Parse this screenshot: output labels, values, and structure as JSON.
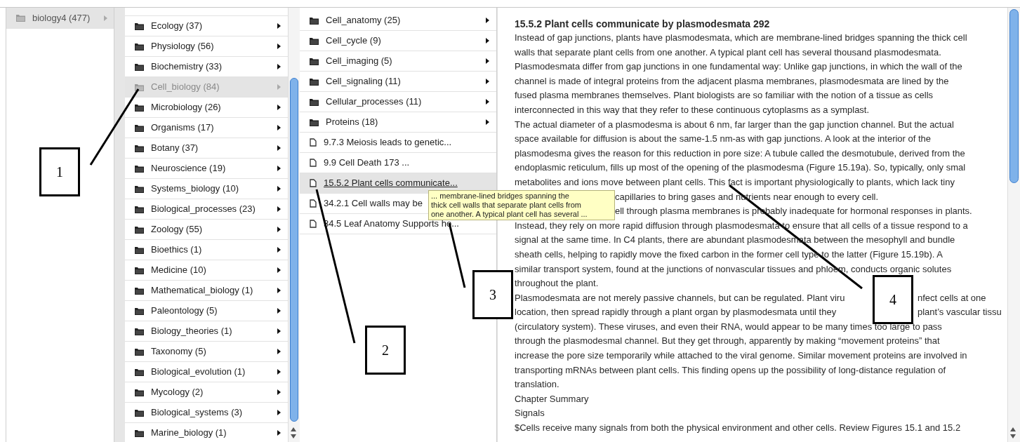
{
  "columns": [
    {
      "items": [
        {
          "label": "biology4 (477)",
          "kind": "folder",
          "selected": true
        }
      ]
    },
    {
      "items": [
        {
          "label": "Ecology (37)",
          "kind": "folder",
          "selected": false
        },
        {
          "label": "Physiology (56)",
          "kind": "folder",
          "selected": false
        },
        {
          "label": "Biochemistry (33)",
          "kind": "folder",
          "selected": false
        },
        {
          "label": "Cell_biology (84)",
          "kind": "folder",
          "selected": true
        },
        {
          "label": "Microbiology (26)",
          "kind": "folder",
          "selected": false
        },
        {
          "label": "Organisms (17)",
          "kind": "folder",
          "selected": false
        },
        {
          "label": "Botany (37)",
          "kind": "folder",
          "selected": false
        },
        {
          "label": "Neuroscience (19)",
          "kind": "folder",
          "selected": false
        },
        {
          "label": "Systems_biology (10)",
          "kind": "folder",
          "selected": false
        },
        {
          "label": "Biological_processes (23)",
          "kind": "folder",
          "selected": false
        },
        {
          "label": "Zoology (55)",
          "kind": "folder",
          "selected": false
        },
        {
          "label": "Bioethics (1)",
          "kind": "folder",
          "selected": false
        },
        {
          "label": "Medicine (10)",
          "kind": "folder",
          "selected": false
        },
        {
          "label": "Mathematical_biology (1)",
          "kind": "folder",
          "selected": false
        },
        {
          "label": "Paleontology (5)",
          "kind": "folder",
          "selected": false
        },
        {
          "label": "Biology_theories (1)",
          "kind": "folder",
          "selected": false
        },
        {
          "label": "Taxonomy (5)",
          "kind": "folder",
          "selected": false
        },
        {
          "label": "Biological_evolution (1)",
          "kind": "folder",
          "selected": false
        },
        {
          "label": "Mycology (2)",
          "kind": "folder",
          "selected": false
        },
        {
          "label": "Biological_systems (3)",
          "kind": "folder",
          "selected": false
        },
        {
          "label": "Marine_biology (1)",
          "kind": "folder",
          "selected": false
        }
      ]
    },
    {
      "items": [
        {
          "label": "Cell_anatomy (25)",
          "kind": "folder",
          "selected": false
        },
        {
          "label": "Cell_cycle (9)",
          "kind": "folder",
          "selected": false
        },
        {
          "label": "Cell_imaging (5)",
          "kind": "folder",
          "selected": false
        },
        {
          "label": "Cell_signaling (11)",
          "kind": "folder",
          "selected": false
        },
        {
          "label": "Cellular_processes (11)",
          "kind": "folder",
          "selected": false
        },
        {
          "label": "Proteins (18)",
          "kind": "folder",
          "selected": false
        },
        {
          "label": "9.7.3 Meiosis leads to genetic...",
          "kind": "document",
          "selected": false
        },
        {
          "label": "9.9 Cell Death 173 ...",
          "kind": "document",
          "selected": false
        },
        {
          "label": "15.5.2 Plant cells communicate...",
          "kind": "document",
          "selected": true
        },
        {
          "label": "34.2.1 Cell walls may be",
          "kind": "document",
          "selected": false
        },
        {
          "label": "34.5 Leaf Anatomy Supports ho...",
          "kind": "document",
          "selected": false
        }
      ]
    }
  ],
  "tooltip": {
    "lines": [
      "...  membrane-lined bridges spanning the",
      "thick cell walls that separate plant cells from",
      "one another. A typical plant cell has several ..."
    ]
  },
  "article": {
    "title": "15.5.2 Plant cells communicate by plasmodesmata 292",
    "lines": [
      {
        "kind": "full",
        "text": "Instead of gap junctions, plants have plasmodesmata, which are membrane-lined bridges spanning the thick cell"
      },
      {
        "kind": "full",
        "text": "walls that separate plant cells from one another. A typical plant cell has several thousand plasmodesmata."
      },
      {
        "kind": "full",
        "text": "Plasmodesmata differ from gap junctions in one fundamental way: Unlike gap junctions, in which the wall of the"
      },
      {
        "kind": "full",
        "text": "channel is made of integral proteins from the adjacent plasma membranes, plasmodesmata are lined by the"
      },
      {
        "kind": "full",
        "text": "fused plasma membranes themselves. Plant biologists are so familiar with the notion of a tissue as cells"
      },
      {
        "kind": "full",
        "text": "interconnected in this way that they refer to these continuous cytoplasms as a symplast."
      },
      {
        "kind": "full",
        "text": "The actual diameter of a plasmodesma is about 6 nm, far larger than the gap junction channel. But the actual"
      },
      {
        "kind": "full",
        "text": "space available for diffusion is about the same-1.5 nm-as with gap junctions. A look at the interior of the"
      },
      {
        "kind": "full",
        "text": "plasmodesma gives the reason for this reduction in pore size: A tubule called the desmotubule, derived from the"
      },
      {
        "kind": "full",
        "text": "endoplasmic reticulum, fills up most of the opening of the plasmodesma (Figure 15.19a). So, typically, only smal"
      },
      {
        "kind": "full",
        "text": "metabolites and ions move between plant cells. This fact is important physiologically to plants, which lack tiny"
      },
      {
        "kind": "after_tooltip",
        "text": "capillaries to bring gases and nutrients near enough to every cell."
      },
      {
        "kind": "after_tooltip",
        "text": "ell through plasma membranes is probably inadequate for hormonal responses in plants."
      },
      {
        "kind": "full",
        "text": "Instead, they rely on more rapid diffusion through plasmodesmata to ensure that all cells of a tissue respond to a"
      },
      {
        "kind": "full",
        "text": "signal at the same time. In C4 plants, there are abundant plasmodesmata between the mesophyll and bundle"
      },
      {
        "kind": "full",
        "text": "sheath cells, helping to rapidly move the fixed carbon in the former cell type to the latter (Figure 15.19b). A"
      },
      {
        "kind": "full",
        "text": "similar transport system, found at the junctions of nonvascular tissues and phloem, conducts organic solutes"
      },
      {
        "kind": "full",
        "text": "throughout the plant."
      },
      {
        "kind": "around_callout",
        "left": "Plasmodesmata are not merely passive channels, but can be regulated. Plant viru",
        "right": "nfect cells at one"
      },
      {
        "kind": "around_callout",
        "left": "location, then spread rapidly through a plant organ by plasmodesmata until they",
        "right": "plant’s vascular tissu"
      },
      {
        "kind": "full",
        "text": "(circulatory system). These viruses, and even their RNA, would appear to be many times too large to pass"
      },
      {
        "kind": "full",
        "text": "through the plasmodesmal channel. But they get through, apparently by making “movement proteins” that"
      },
      {
        "kind": "full",
        "text": "increase the pore size temporarily while attached to the viral genome. Similar movement proteins are involved in"
      },
      {
        "kind": "full",
        "text": "transporting mRNAs between plant cells. This finding opens up the possibility of long-distance regulation of"
      },
      {
        "kind": "full",
        "text": "translation."
      },
      {
        "kind": "full",
        "text": "Chapter Summary"
      },
      {
        "kind": "full",
        "text": "Signals"
      },
      {
        "kind": "full",
        "text": "$Cells receive many signals from both the physical environment and other cells. Review Figures 15.1 and 15.2"
      }
    ]
  },
  "callouts": [
    {
      "label": "1"
    },
    {
      "label": "2"
    },
    {
      "label": "3"
    },
    {
      "label": "4"
    }
  ]
}
